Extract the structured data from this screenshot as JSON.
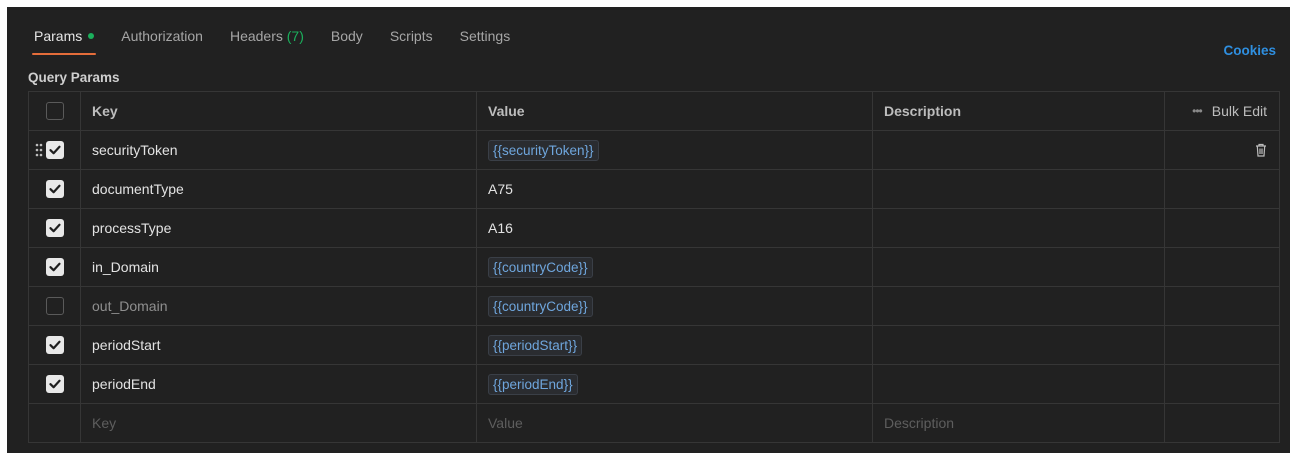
{
  "tabs": [
    {
      "label": "Params",
      "active": true,
      "indicator": "green-dot"
    },
    {
      "label": "Authorization",
      "active": false
    },
    {
      "label": "Headers",
      "count": "(7)",
      "active": false
    },
    {
      "label": "Body",
      "active": false
    },
    {
      "label": "Scripts",
      "active": false
    },
    {
      "label": "Settings",
      "active": false
    }
  ],
  "cookies_label": "Cookies",
  "section_title": "Query Params",
  "table": {
    "headers": {
      "key": "Key",
      "value": "Value",
      "description": "Description",
      "bulk_edit": "Bulk Edit"
    },
    "rows": [
      {
        "checked": true,
        "key": "securityToken",
        "value": "{{securityToken}}",
        "is_variable": true,
        "description": ""
      },
      {
        "checked": true,
        "key": "documentType",
        "value": "A75",
        "is_variable": false,
        "description": ""
      },
      {
        "checked": true,
        "key": "processType",
        "value": "A16",
        "is_variable": false,
        "description": ""
      },
      {
        "checked": true,
        "key": "in_Domain",
        "value": "{{countryCode}}",
        "is_variable": true,
        "description": ""
      },
      {
        "checked": false,
        "key": "out_Domain",
        "value": "{{countryCode}}",
        "is_variable": true,
        "description": ""
      },
      {
        "checked": true,
        "key": "periodStart",
        "value": "{{periodStart}}",
        "is_variable": true,
        "description": ""
      },
      {
        "checked": true,
        "key": "periodEnd",
        "value": "{{periodEnd}}",
        "is_variable": true,
        "description": ""
      }
    ],
    "new_row": {
      "key_placeholder": "Key",
      "value_placeholder": "Value",
      "description_placeholder": "Description"
    }
  },
  "colors": {
    "accent_tab": "#e56d3a",
    "indicator": "#1bb05c",
    "link": "#2f8fe0",
    "variable": "#6fa6dd"
  }
}
